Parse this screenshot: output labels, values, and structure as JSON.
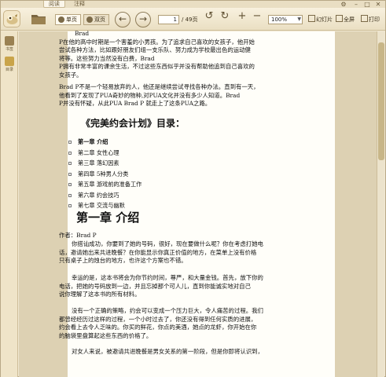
{
  "tabs": {
    "read": "阅读",
    "annotate": "注释"
  },
  "toolbar": {
    "single_page": "单页",
    "double_page": "双页",
    "page_current": "1",
    "page_total": "/ 49页",
    "zoom": "100%",
    "slideshow": "幻灯片",
    "fullscreen": "全屏",
    "print": "打印"
  },
  "sidebar": {
    "bookmarks": "书签",
    "contents": "目录"
  },
  "document": {
    "para1": [
      "Brad",
      "P在他的高中时期是一个害羞的小男孩。为了追求自己喜欢的女孩子，他开始",
      "尝试各种方法，比如跟好朋友们组一支乐队、努力成为学校最出色的运动健",
      "将等。这些努力当然没有白费，Brad",
      "P拥有非常丰富的课余生活，不过这些东西似乎并没有帮助他追到自己喜欢的",
      "女孩子。"
    ],
    "para2": [
      "Brad P不是一个轻易放弃的人，他还是继续尝试寻找各种办法。直到有一天，",
      "他看到了发现了PUA奇妙的物种,对PUA文化并没有多少人知道。Brad",
      "P并没有怀疑，从此PUA Brad P 就走上了这条PUA之路。"
    ],
    "toc_title": "《完美约会计划》目录：",
    "toc": [
      "第一章 介绍",
      "第二章 女性心理",
      "第三章 落幻因素",
      "第四章 5种男人分类",
      "第五章 游戏前的准备工作",
      "第六章 约会技巧",
      "第七章 交流与幽默"
    ],
    "chapter_title": "第一章 介绍",
    "author": "作者：Brad P",
    "para3": [
      "你搭讪成功，你要到了她的号码，很好，现在要做什么呢？你在考虑打她电",
      "话，邀请她出来共进晚餐？在你能显示你真正价值的地方，在菜单上没有价格",
      "只有桌子上的烛台的地方，也许这个方案也不错。"
    ],
    "para4": [
      "幸运的是，这本书将会为你节约时间，尊严，和大量金钱。首先，放下你的",
      "电话，把她的号码放到一边，并且忘掉那个可人儿，直到你能诚实地对自己",
      "说你理解了这本书的所有材料。"
    ],
    "para5": [
      "没有一个正确的策略，约会可以变成一个压力巨大，令人痛苦的过程。我们",
      "都曾经经历过这样的过程，一个小时过去了，你还没有得到任何实质的进展，",
      "约会看上去令人乏味的。你买的鲜花，你点的美酒，她点的龙虾，你开始在你",
      "的脑袋里盘算起这些东西的价格了。"
    ],
    "para6": "对女人来说，被邀请共进晚餐是男女关系的第一阶段，但是你即将认识到，"
  }
}
